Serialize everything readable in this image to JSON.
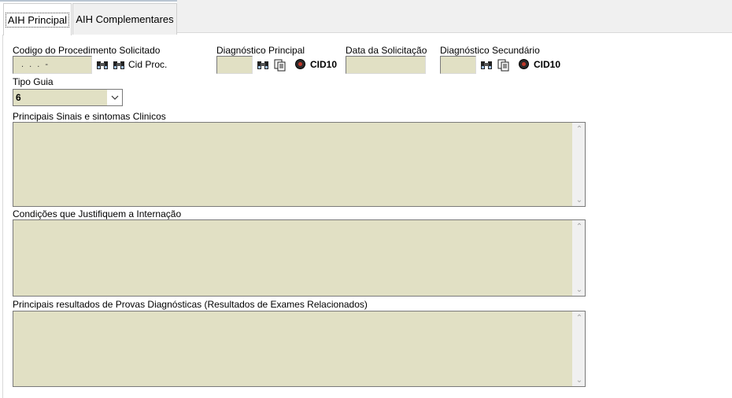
{
  "tabs": [
    {
      "label": "AIH Principal",
      "active": true
    },
    {
      "label": "AIH Complementares",
      "active": false
    }
  ],
  "fields": {
    "codigo_procedimento": {
      "label": "Codigo do Procedimento Solicitado",
      "value": " .  .  .  -",
      "cid_proc_label": "Cid Proc."
    },
    "diagnostico_principal": {
      "label": "Diagnóstico Principal",
      "value": "",
      "cid_label": "CID10"
    },
    "data_solicitacao": {
      "label": "Data da Solicitação",
      "value": ""
    },
    "diagnostico_secundario": {
      "label": "Diagnóstico Secundário",
      "value": "",
      "cid_label": "CID10"
    },
    "tipo_guia": {
      "label": "Tipo Guia",
      "value": "6"
    }
  },
  "memos": {
    "sinais_sintomas": {
      "label": "Principais Sinais e sintomas Clinicos",
      "value": ""
    },
    "condicoes": {
      "label": "Condições que Justifiquem a Internação",
      "value": ""
    },
    "resultados": {
      "label": "Principais resultados de Provas Diagnósticas (Resultados de Exames Relacionados)",
      "value": ""
    }
  },
  "icons": {
    "search": "binoculars-icon",
    "copy": "copy-pages-icon",
    "radio": "radio-selected-icon",
    "dropdown": "chevron-down-icon"
  },
  "colors": {
    "field_bg": "#e1e0c4",
    "radio_dot": "#c0392b"
  }
}
